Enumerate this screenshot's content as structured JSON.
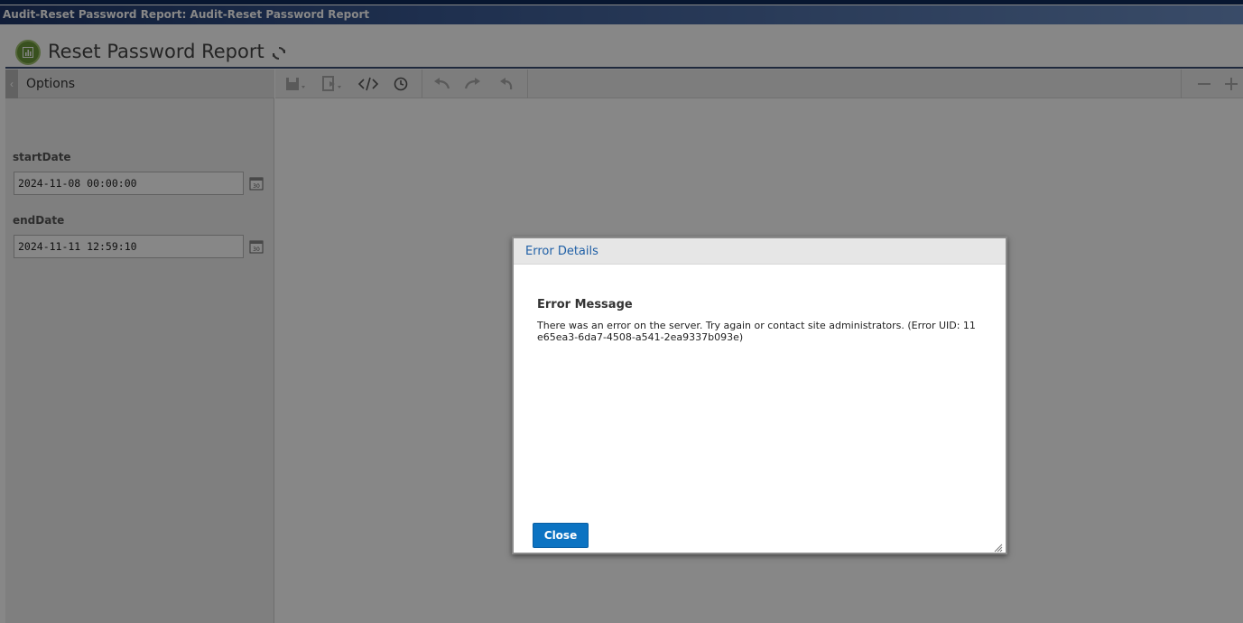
{
  "window": {
    "title": "Audit-Reset Password Report: Audit-Reset Password Report"
  },
  "header": {
    "report_title": "Reset Password Report",
    "icons": [
      "report-icon",
      "refresh-icon"
    ]
  },
  "left_panel": {
    "collapse_glyph": "‹",
    "options_label": "Options",
    "params": [
      {
        "label": "startDate",
        "value": "2024-11-08 00:00:00",
        "icon": "calendar-icon"
      },
      {
        "label": "endDate",
        "value": "2024-11-11 12:59:10",
        "icon": "calendar-icon"
      }
    ]
  },
  "toolbar": {
    "icons": [
      "save-icon",
      "export-icon",
      "code-icon",
      "history-icon",
      "undo-icon",
      "redo-icon",
      "undo-all-icon",
      "zoom-out-icon",
      "zoom-in-icon"
    ]
  },
  "dialog": {
    "title": "Error Details",
    "heading": "Error Message",
    "message": "There was an error on the server. Try again or contact site administrators. (Error UID: 11e65ea3-6da7-4508-a541-2ea9337b093e)",
    "close_label": "Close"
  },
  "colors": {
    "title_bar_start": "#20386a",
    "title_bar_end": "#6d8fc4",
    "dialog_title": "#1f5fa6",
    "close_button": "#0c73c2",
    "report_icon": "#6d9a3c"
  }
}
